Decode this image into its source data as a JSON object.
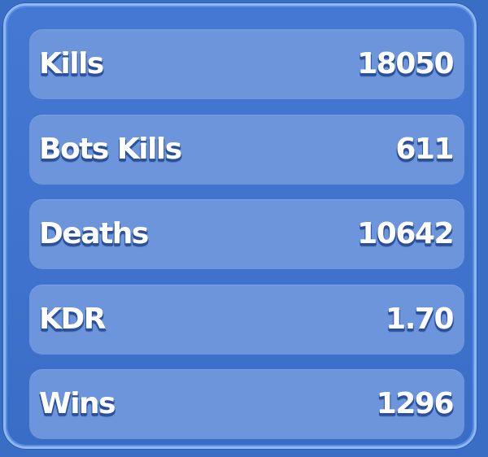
{
  "stats": [
    {
      "label": "Kills",
      "value": "18050"
    },
    {
      "label": "Bots Kills",
      "value": "611"
    },
    {
      "label": "Deaths",
      "value": "10642"
    },
    {
      "label": "KDR",
      "value": "1.70"
    },
    {
      "label": "Wins",
      "value": "1296"
    }
  ],
  "colors": {
    "background": "#3a6ec4",
    "panel_border": "#8fb8f2",
    "row_fill": "#6c95dc",
    "text": "#ffffff",
    "text_shadow": "#2a4f9c"
  }
}
